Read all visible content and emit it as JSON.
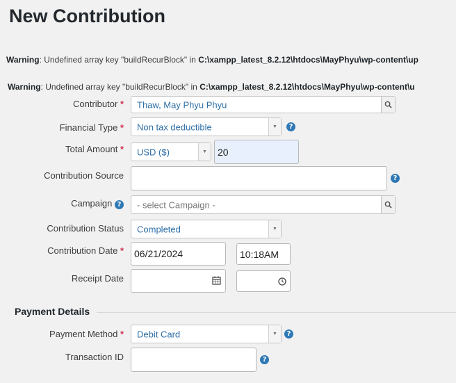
{
  "page": {
    "title": "New Contribution"
  },
  "warnings": [
    {
      "label": "Warning",
      "text": ": Undefined array key \"buildRecurBlock\" in ",
      "path": "C:\\xampp_latest_8.2.12\\htdocs\\MayPhyu\\wp-content\\up"
    },
    {
      "label": "Warning",
      "text": ": Undefined array key \"buildRecurBlock\" in ",
      "path": "C:\\xampp_latest_8.2.12\\htdocs\\MayPhyu\\wp-content\\u"
    }
  ],
  "form": {
    "contributor": {
      "label": "Contributor",
      "required": "*",
      "value": "Thaw, May Phyu Phyu"
    },
    "financial_type": {
      "label": "Financial Type",
      "required": "*",
      "value": "Non tax deductible"
    },
    "total_amount": {
      "label": "Total Amount",
      "required": "*",
      "currency": "USD ($)",
      "value": "20"
    },
    "contribution_source": {
      "label": "Contribution Source",
      "value": ""
    },
    "campaign": {
      "label": "Campaign",
      "placeholder": "- select Campaign -"
    },
    "contribution_status": {
      "label": "Contribution Status",
      "value": "Completed"
    },
    "contribution_date": {
      "label": "Contribution Date",
      "required": "*",
      "date": "06/21/2024",
      "time": "10:18AM"
    },
    "receipt_date": {
      "label": "Receipt Date",
      "date": "",
      "time": ""
    }
  },
  "payment": {
    "section_title": "Payment Details",
    "payment_method": {
      "label": "Payment Method",
      "required": "*",
      "value": "Debit Card"
    },
    "transaction_id": {
      "label": "Transaction ID",
      "value": ""
    }
  },
  "icons": {
    "help": "question-circle-icon",
    "search": "search-icon",
    "calendar": "calendar-icon",
    "clock": "clock-icon",
    "dropdown": "caret-down-icon"
  },
  "colors": {
    "required": "#cf3458",
    "link_value": "#2e6fa7",
    "help_icon": "#2e78b6",
    "amount_bg": "#e8f0fe"
  }
}
